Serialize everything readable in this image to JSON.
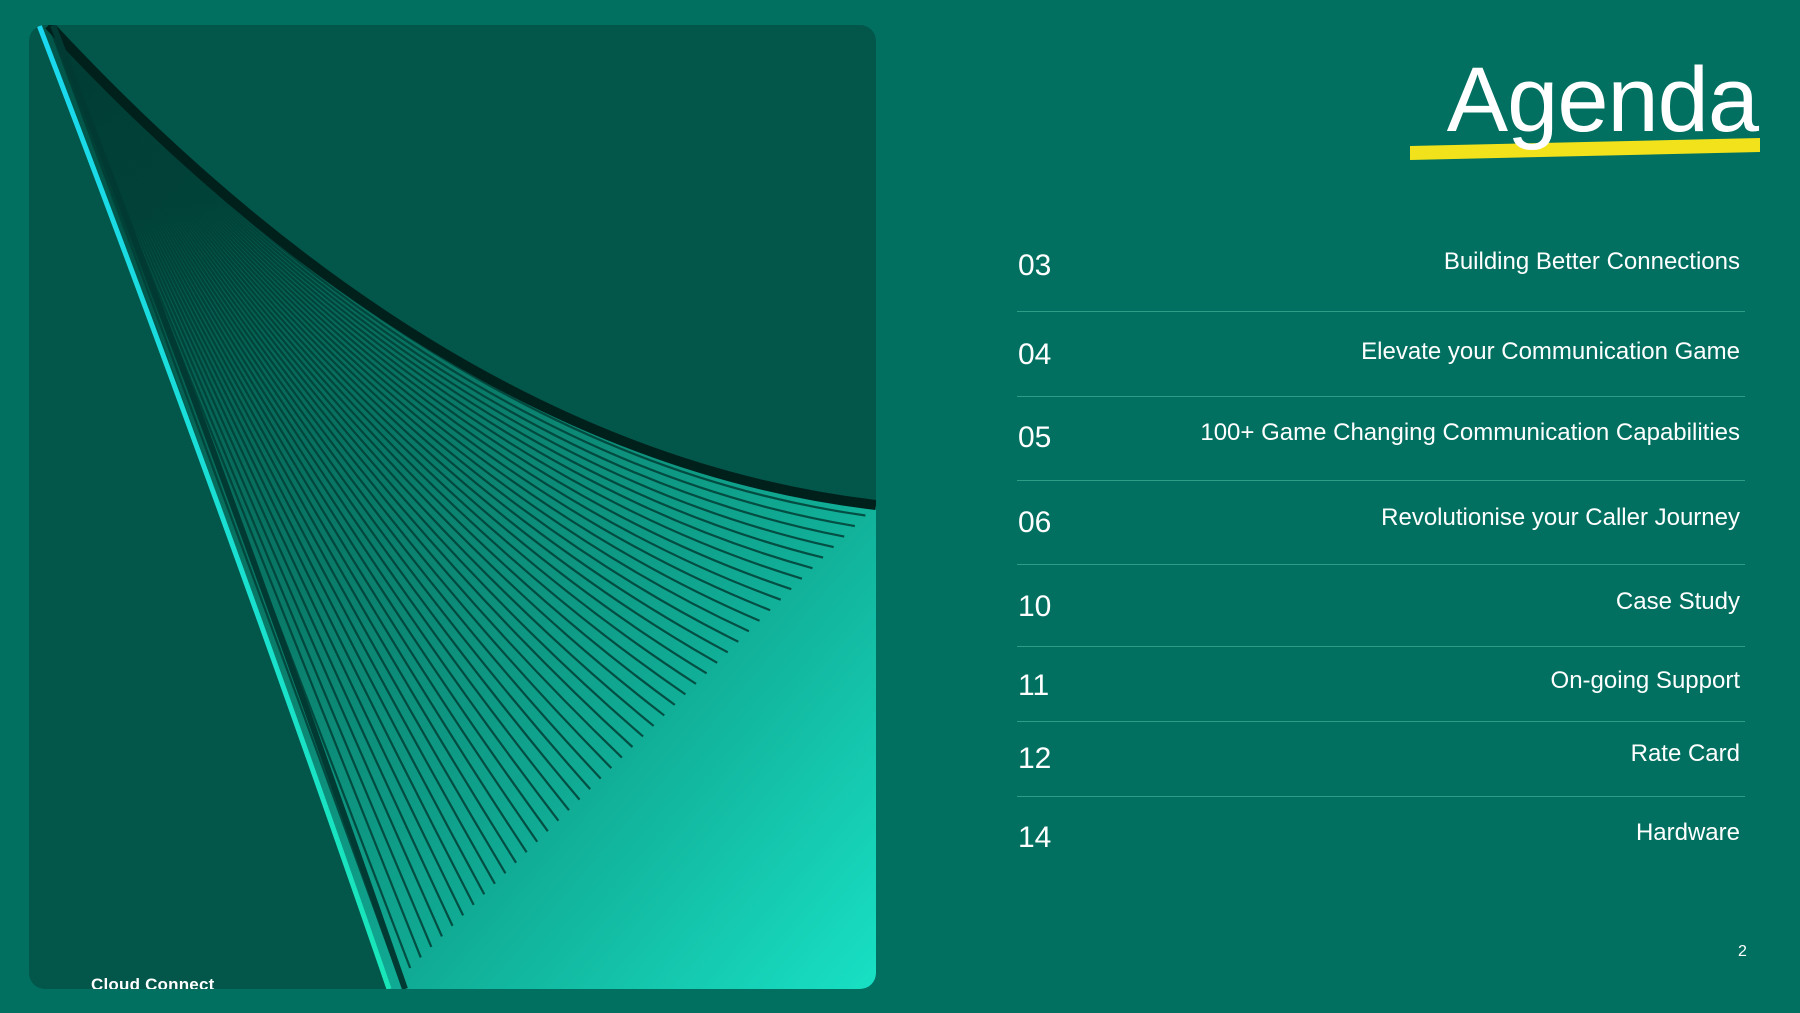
{
  "slide": {
    "title": "Agenda",
    "brand": "Cloud Connect",
    "page_number": "2"
  },
  "agenda": [
    {
      "number": "03",
      "label": "Building Better Connections"
    },
    {
      "number": "04",
      "label": "Elevate your Communication Game"
    },
    {
      "number": "05",
      "label": "100+ Game Changing Communication Capabilities"
    },
    {
      "number": "06",
      "label": "Revolutionise your Caller Journey"
    },
    {
      "number": "10",
      "label": "Case Study"
    },
    {
      "number": "11",
      "label": "On-going Support"
    },
    {
      "number": "12",
      "label": "Rate Card"
    },
    {
      "number": "14",
      "label": "Hardware"
    }
  ],
  "colors": {
    "background": "#017061",
    "panel": "#02564a",
    "accent_yellow": "#f2e21b",
    "wave_cyan": "#17e3cf",
    "text": "#ffffff"
  }
}
